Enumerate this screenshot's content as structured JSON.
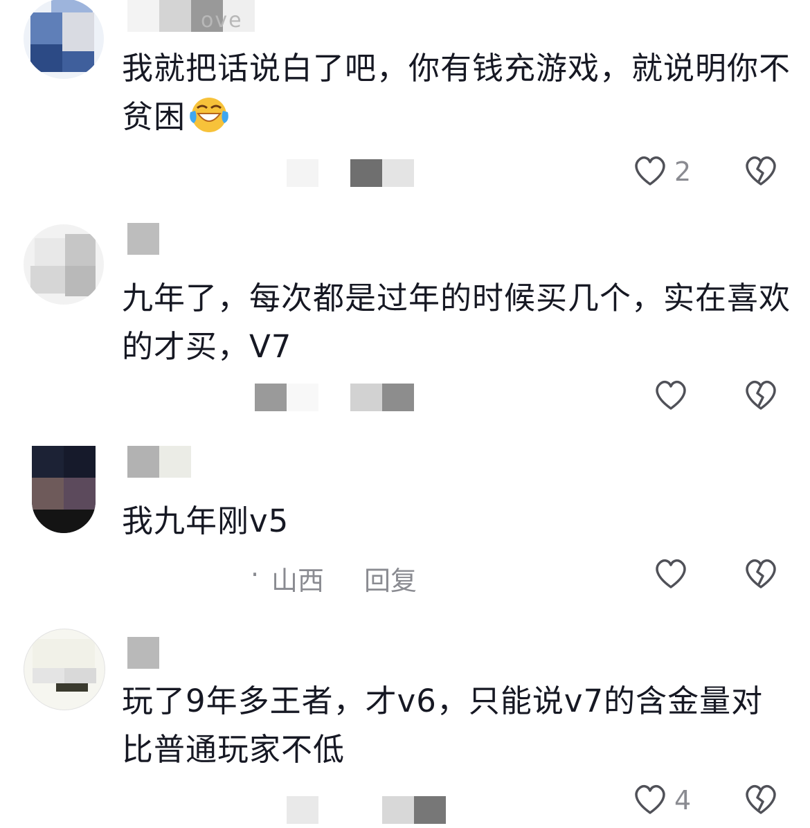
{
  "comments": [
    {
      "name_fragment": "ove",
      "text": "我就把话说白了吧，你有钱充游戏，就说明你不贫困",
      "emoji": "laughing-crying-emoji",
      "meta_location": "",
      "meta_reply": "",
      "like_count": "2"
    },
    {
      "name_fragment": "",
      "text": "九年了，每次都是过年的时候买几个，实在喜欢的才买，V7",
      "meta_location": "",
      "meta_reply": "",
      "like_count": ""
    },
    {
      "name_fragment": "",
      "text": "我九年刚v5",
      "meta_prefix": "·",
      "meta_location": "山西",
      "meta_reply": "回复",
      "like_count": ""
    },
    {
      "name_fragment": "",
      "text": "玩了9年多王者，才v6，只能说v7的含金量对比普通玩家不低",
      "meta_location": "",
      "meta_reply": "",
      "like_count": "4"
    }
  ],
  "icons": {
    "like": "heart-outline-icon",
    "dislike": "broken-heart-icon"
  },
  "colors": {
    "text": "#161823",
    "meta": "#8a8b91",
    "background": "#ffffff"
  }
}
